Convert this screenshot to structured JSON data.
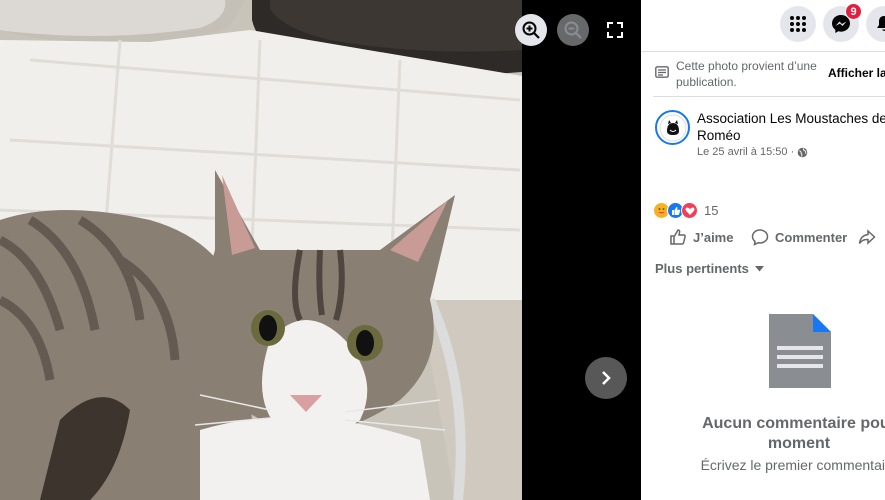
{
  "viewer": {
    "zoom_in_icon": "zoom-in-icon",
    "zoom_out_icon": "zoom-out-icon",
    "fullscreen_icon": "fullscreen-icon",
    "next_icon": "chevron-right-icon"
  },
  "topbar": {
    "menu_icon": "grid-menu-icon",
    "messenger_icon": "messenger-icon",
    "messenger_badge": "9",
    "notifications_icon": "bell-icon"
  },
  "notice": {
    "text": "Cette photo provient d’une publication.",
    "link": "Afficher la p"
  },
  "post": {
    "author_line1": "Association Les Moustaches de",
    "author_line2": "Roméo",
    "date": "Le 25 avril à 15:50 ·",
    "privacy_icon": "globe-icon"
  },
  "reactions": {
    "types": [
      "care",
      "like",
      "love"
    ],
    "count": "15"
  },
  "actions": {
    "like": "J’aime",
    "comment": "Commenter"
  },
  "comments": {
    "sort_label": "Plus pertinents",
    "empty_title_1": "Aucun commentaire pour",
    "empty_title_2": "moment",
    "empty_subtitle": "Écrivez le premier commentaire"
  },
  "colors": {
    "accent": "#1877f2",
    "badge": "#e41e3f",
    "muted_text": "#65676b"
  }
}
